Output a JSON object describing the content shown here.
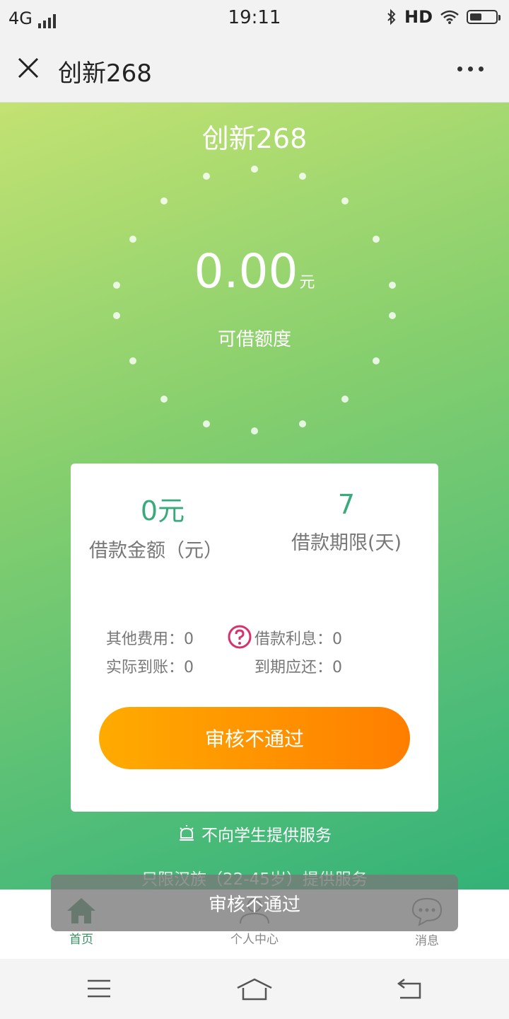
{
  "status_bar": {
    "network": "4G",
    "time": "19:11",
    "hd": "HD"
  },
  "nav": {
    "title": "创新268"
  },
  "hero": {
    "app_title": "创新268",
    "amount": "0.00",
    "amount_unit": "元",
    "limit_label": "可借额度"
  },
  "card": {
    "loan_amount_value": "0元",
    "loan_amount_label": "借款金额（元）",
    "loan_term_value": "7",
    "loan_term_label": "借款期限(天)",
    "fees": {
      "other_fees": "其他费用：0",
      "interest": "借款利息：0",
      "actual_received": "实际到账：0",
      "due_repay": "到期应还：0"
    },
    "button_label": "审核不通过"
  },
  "notices": {
    "no_students": "不向学生提供服务",
    "han_only": "只限汉族（22-45岁）提供服务"
  },
  "toast": {
    "message": "审核不通过"
  },
  "tabbar": {
    "tabs": [
      {
        "label": "首页",
        "icon": "home-icon",
        "active": true
      },
      {
        "label": "个人中心",
        "icon": "person-icon",
        "active": false
      },
      {
        "label": "消息",
        "icon": "message-icon",
        "active": false
      }
    ]
  },
  "colors": {
    "accent_green": "#3aaa7c",
    "button_start": "#ffab00",
    "button_end": "#ff7e00",
    "question_pink": "#d6336c"
  }
}
